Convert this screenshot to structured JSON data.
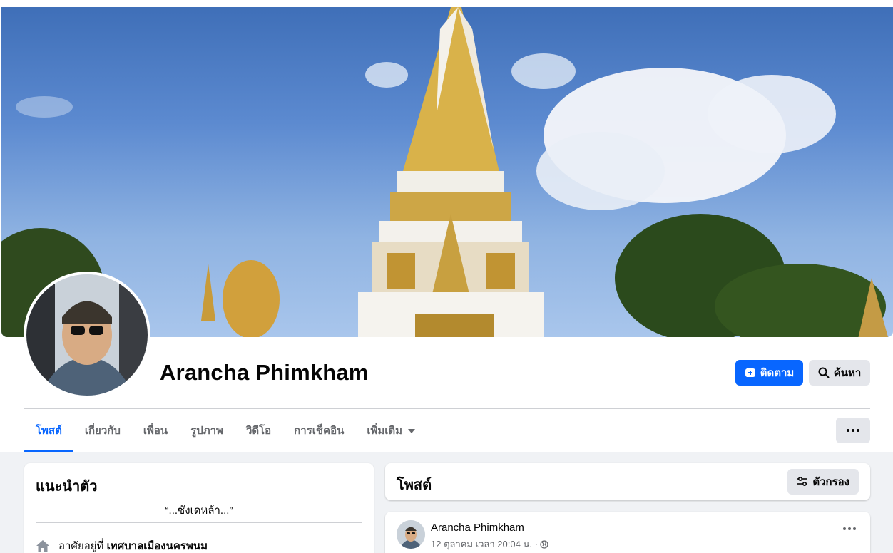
{
  "profile": {
    "name": "Arancha Phimkham",
    "follow_label": "ติดตาม",
    "search_label": "ค้นหา"
  },
  "tabs": [
    {
      "label": "โพสต์",
      "active": true
    },
    {
      "label": "เกี่ยวกับ",
      "active": false
    },
    {
      "label": "เพื่อน",
      "active": false
    },
    {
      "label": "รูปภาพ",
      "active": false
    },
    {
      "label": "วิดีโอ",
      "active": false
    },
    {
      "label": "การเช็คอิน",
      "active": false
    },
    {
      "label": "เพิ่มเติม",
      "active": false
    }
  ],
  "intro": {
    "title": "แนะนำตัว",
    "bio": "“...ซังเดหล้า...”",
    "lives_prefix": "อาศัยอยู่ที่",
    "lives_place": "เทศบาลเมืองนครพนม"
  },
  "posts": {
    "title": "โพสต์",
    "filter_label": "ตัวกรอง"
  },
  "post": {
    "author": "Arancha Phimkham",
    "time": "12 ตุลาคม เวลา 20:04 น. ·"
  },
  "colors": {
    "accent": "#0866ff",
    "button_gray": "#e4e6eb",
    "page_bg": "#f0f2f5"
  }
}
